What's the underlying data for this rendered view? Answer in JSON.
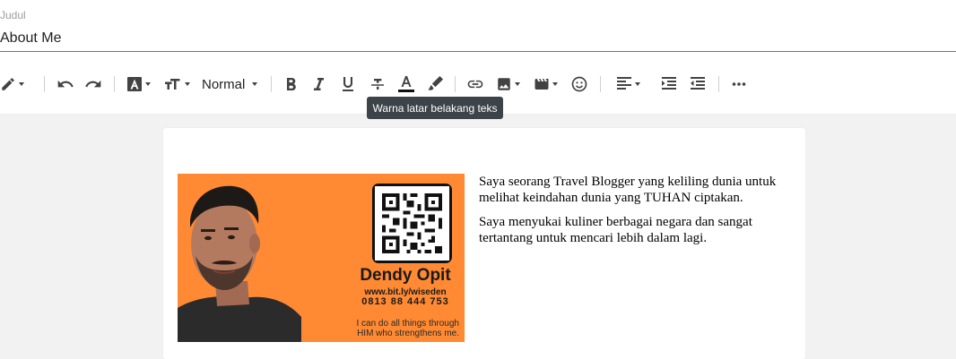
{
  "title": {
    "label": "Judul",
    "value": "About Me",
    "underline_color": "#e65100"
  },
  "toolbar": {
    "items": [
      {
        "icon": "pencil-icon",
        "has_caret": true
      },
      {
        "icon": "undo-icon"
      },
      {
        "icon": "redo-icon"
      },
      {
        "icon": "font-family-icon",
        "has_caret": true
      },
      {
        "icon": "font-size-icon",
        "has_caret": true
      },
      {
        "icon": "bold-icon"
      },
      {
        "icon": "italic-icon"
      },
      {
        "icon": "underline-icon"
      },
      {
        "icon": "strikethrough-icon"
      },
      {
        "icon": "text-color-icon"
      },
      {
        "icon": "highlight-icon"
      },
      {
        "icon": "link-icon"
      },
      {
        "icon": "image-icon",
        "has_caret": true
      },
      {
        "icon": "video-icon",
        "has_caret": true
      },
      {
        "icon": "emoji-icon"
      },
      {
        "icon": "align-icon",
        "has_caret": true
      },
      {
        "icon": "indent-icon"
      },
      {
        "icon": "outdent-icon"
      },
      {
        "icon": "more-icon"
      }
    ],
    "format": "Normal"
  },
  "tooltip": {
    "text": "Warna latar belakang teks"
  },
  "post": {
    "card": {
      "background": "#ff8a33",
      "name": "Dendy Opit",
      "website": "www.bit.ly/wiseden",
      "phone": "0813 88 444 753",
      "quote_line1": "I can do all things through",
      "quote_line2": "HIM who strengthens me."
    },
    "paragraphs": [
      "Saya seorang Travel Blogger yang keliling dunia untuk melihat keindahan dunia yang TUHAN ciptakan.",
      "Saya menyukai kuliner berbagai negara dan sangat tertantang untuk mencari lebih dalam lagi."
    ]
  }
}
